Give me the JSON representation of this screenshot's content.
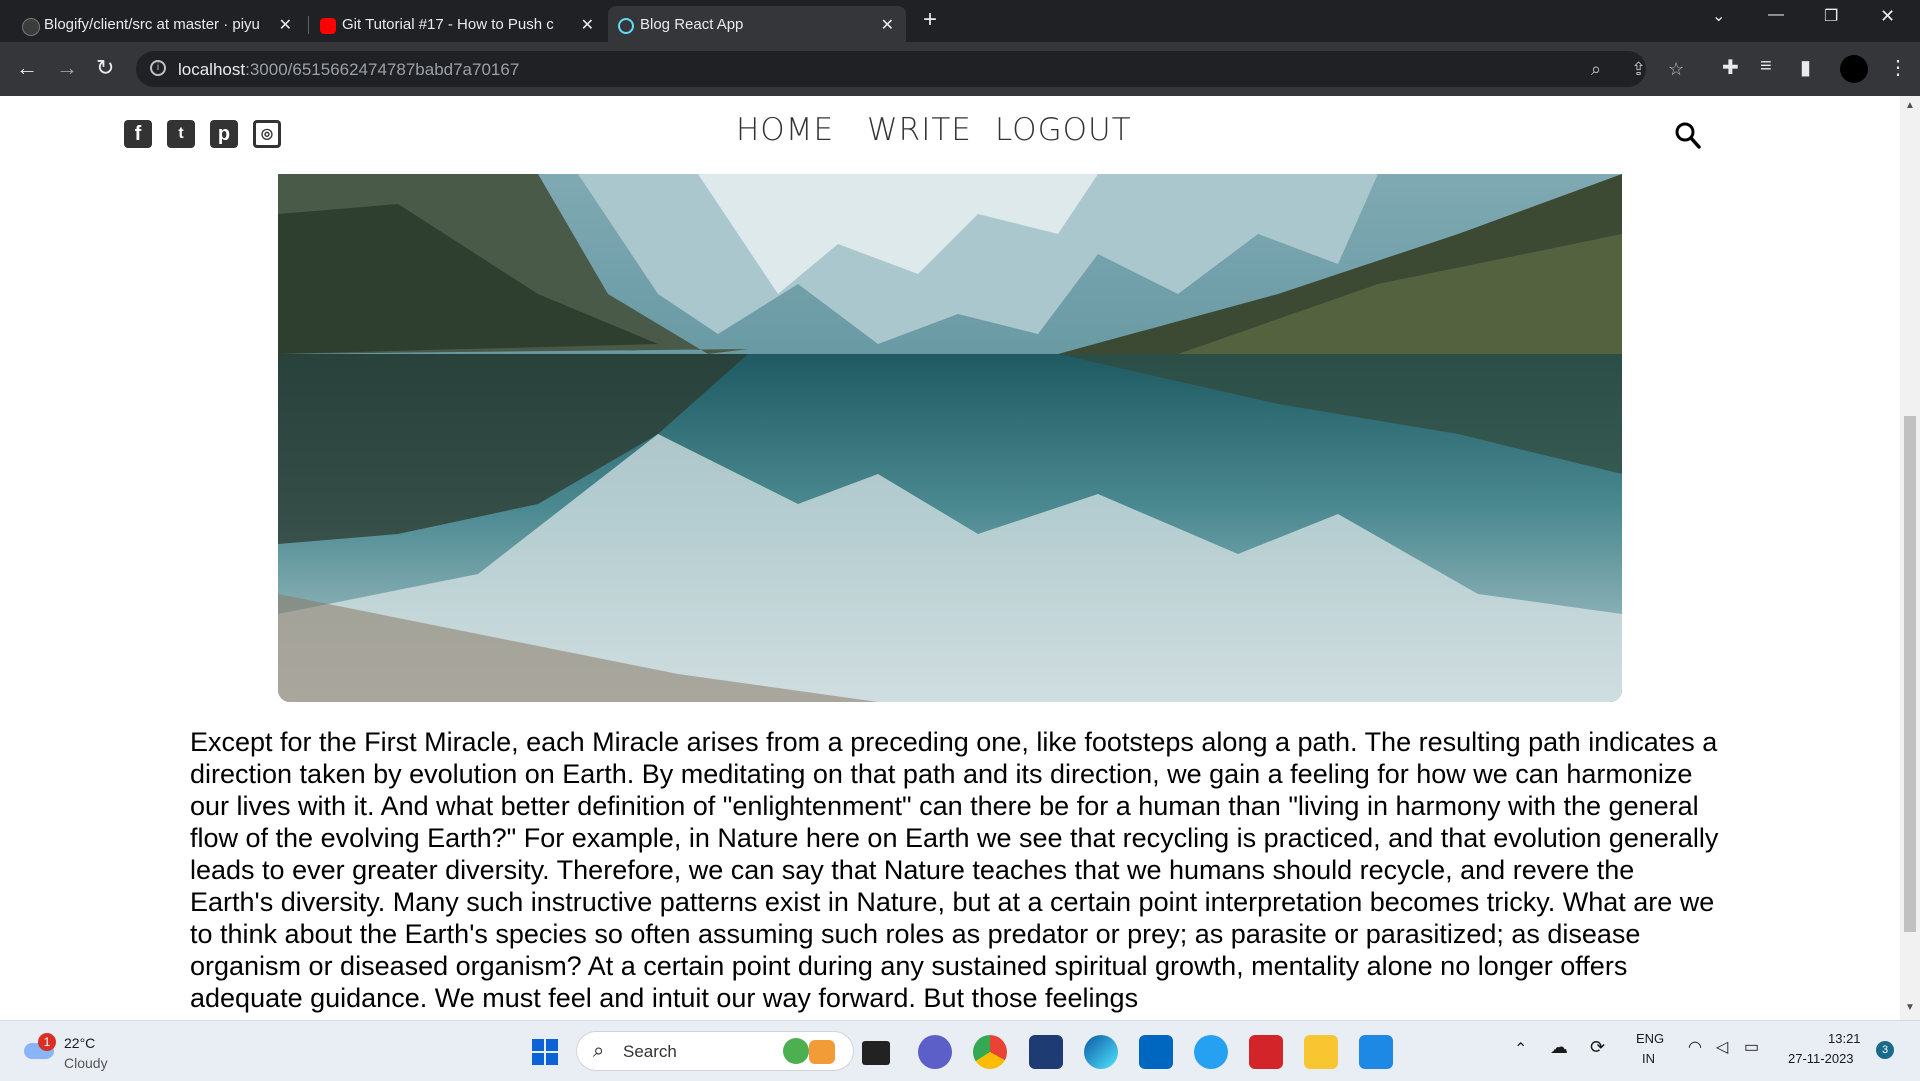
{
  "browser": {
    "tabs": [
      {
        "title": "Blogify/client/src at master · piyu",
        "favicon": "github-icon",
        "active": false
      },
      {
        "title": "Git Tutorial #17 - How to Push c",
        "favicon": "youtube-icon",
        "active": false
      },
      {
        "title": "Blog React App",
        "favicon": "react-icon",
        "active": true
      }
    ],
    "url_host": "localhost",
    "url_path": ":3000/6515662474787babd7a70167"
  },
  "site": {
    "nav": [
      "HOME",
      "WRITE",
      "LOGOUT"
    ],
    "social_icons": [
      "facebook-icon",
      "twitter-icon",
      "pinterest-icon",
      "instagram-icon"
    ],
    "post_body": "Except for the First Miracle, each Miracle arises from a preceding one, like footsteps along a path. The resulting path indicates a direction taken by evolution on Earth. By meditating on that path and its direction, we gain a feeling for how we can harmonize our lives with it. And what better definition of \"enlightenment\" can there be for a human than \"living in harmony with the general flow of the evolving Earth?\" For example, in Nature here on Earth we see that recycling is practiced, and that evolution generally leads to ever greater diversity. Therefore, we can say that Nature teaches that we humans should recycle, and revere the Earth's diversity. Many such instructive patterns exist in Nature, but at a certain point interpretation becomes tricky. What are we to think about the Earth's species so often assuming such roles as predator or prey; as parasite or parasitized; as disease organism or diseased organism? At a certain point during any sustained spiritual growth, mentality alone no longer offers adequate guidance. We must feel and intuit our way forward. But those feelings"
  },
  "taskbar": {
    "weather_temp": "22°C",
    "weather_desc": "Cloudy",
    "weather_badge": "1",
    "search_label": "Search",
    "lang_top": "ENG",
    "lang_bottom": "IN",
    "time": "13:21",
    "date": "27-11-2023",
    "notif_count": "3"
  }
}
